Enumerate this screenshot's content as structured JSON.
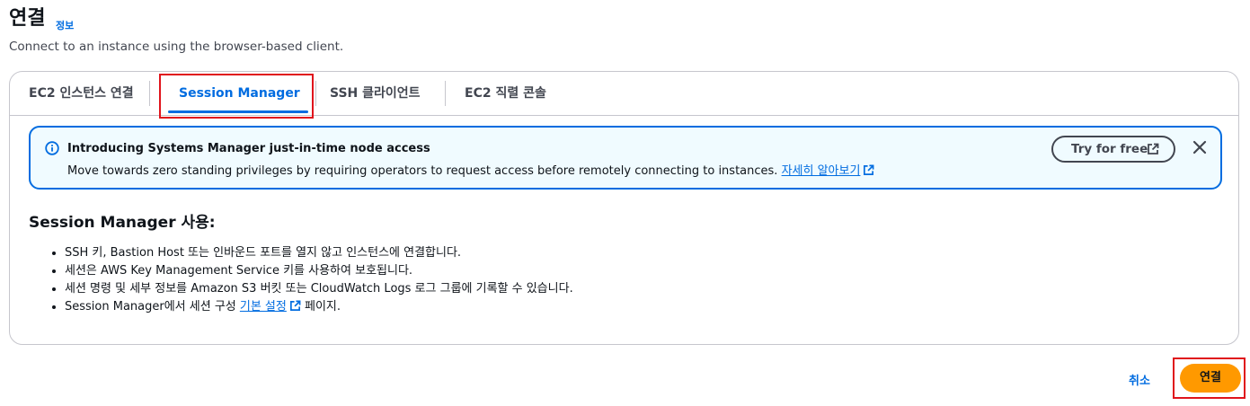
{
  "header": {
    "title": "연결",
    "info_link": "정보",
    "subtitle": "Connect to an instance using the browser-based client."
  },
  "tabs": [
    {
      "label": "EC2 인스턴스 연결",
      "active": false
    },
    {
      "label": "Session Manager",
      "active": true
    },
    {
      "label": "SSH 클라이언트",
      "active": false
    },
    {
      "label": "EC2 직렬 콘솔",
      "active": false
    }
  ],
  "banner": {
    "icon": "info-icon",
    "title": "Introducing Systems Manager just-in-time node access",
    "text": "Move towards zero standing privileges by requiring operators to request access before remotely connecting to instances.",
    "link_label": "자세히 알아보기",
    "try_button_label": "Try for free",
    "close_icon": "close-icon"
  },
  "section": {
    "title": "Session Manager 사용:",
    "bullets": [
      "SSH 키, Bastion Host 또는 인바운드 포트를 열지 않고 인스턴스에 연결합니다.",
      "세션은 AWS Key Management Service 키를 사용하여 보호됩니다.",
      "세션 명령 및 세부 정보를 Amazon S3 버킷 또는 CloudWatch Logs 로그 그룹에 기록할 수 있습니다."
    ],
    "last_bullet": {
      "prefix": "Session Manager에서 세션 구성 ",
      "link": "기본 설정",
      "suffix": " 페이지."
    }
  },
  "footer": {
    "cancel_label": "취소",
    "connect_label": "연결"
  },
  "colors": {
    "accent": "#006ce0",
    "primary_button": "#ff9900",
    "highlight_box": "#e0141c",
    "banner_background": "#f0fbff"
  }
}
